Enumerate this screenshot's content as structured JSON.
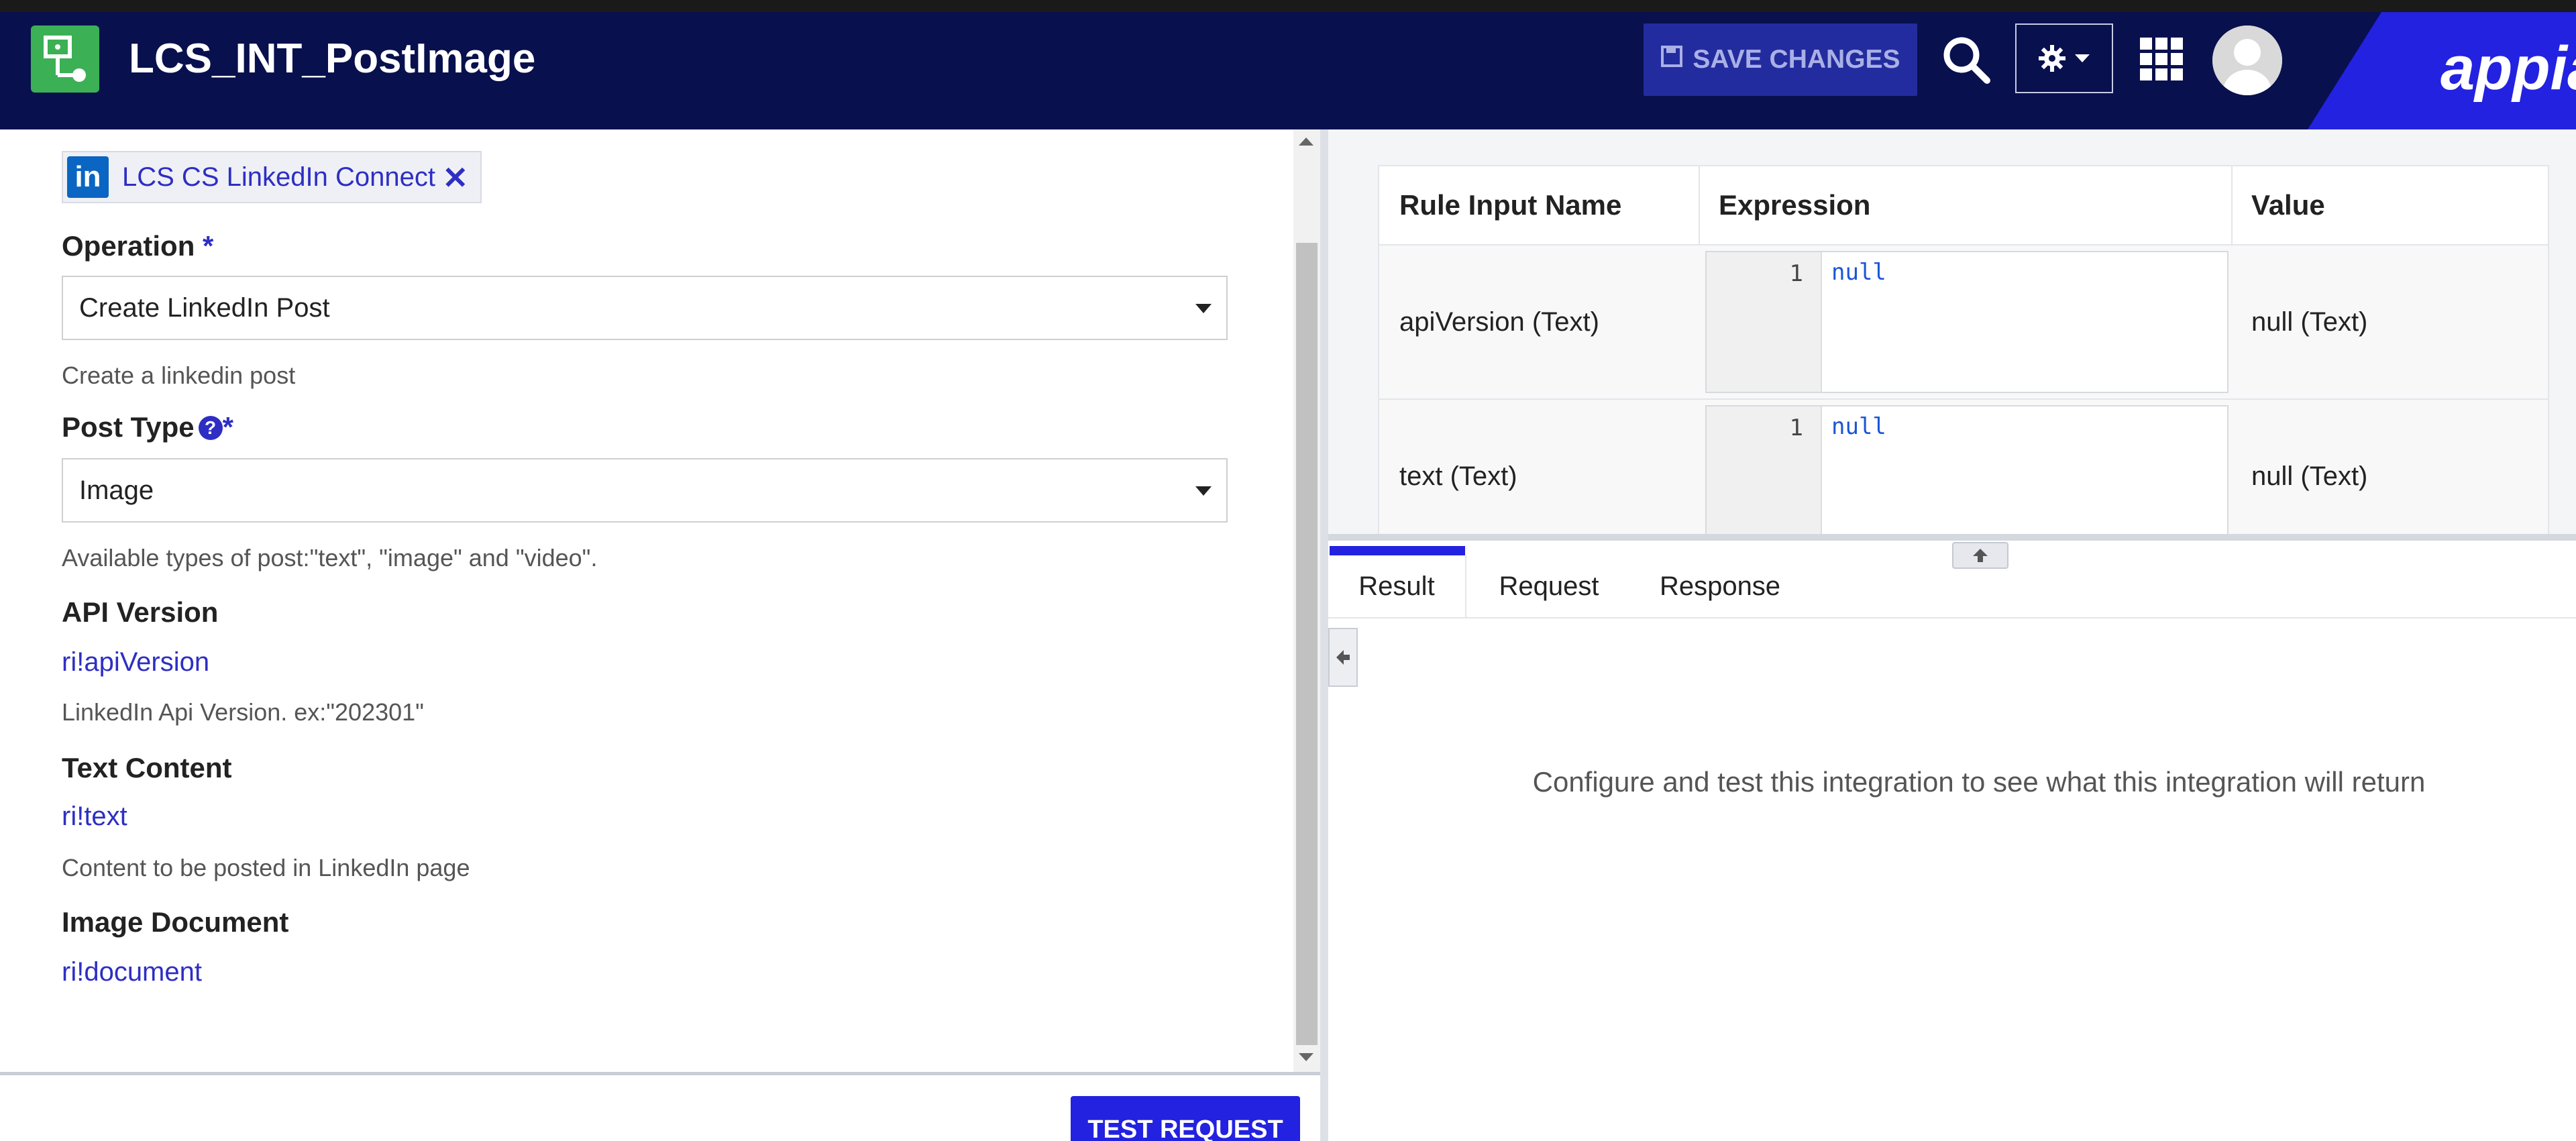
{
  "header": {
    "app_title": "LCS_INT_PostImage",
    "save_label": "SAVE CHANGES",
    "brand": "appia"
  },
  "connection": {
    "label": "LCS CS LinkedIn Connect",
    "logo_text": "in"
  },
  "form": {
    "operation": {
      "label": "Operation",
      "required_mark": "*",
      "value": "Create LinkedIn Post",
      "hint": "Create a linkedin post"
    },
    "post_type": {
      "label": "Post Type",
      "required_mark": "*",
      "help": "?",
      "value": "Image",
      "hint": "Available types of post:\"text\", \"image\" and \"video\"."
    },
    "api_version": {
      "label": "API Version",
      "rule": "ri!apiVersion",
      "hint": "LinkedIn Api Version. ex:\"202301\""
    },
    "text_content": {
      "label": "Text Content",
      "rule": "ri!text",
      "hint": "Content to be posted in LinkedIn page"
    },
    "image_document": {
      "label": "Image Document",
      "rule": "ri!document"
    }
  },
  "test_button": "TEST REQUEST",
  "rule_table": {
    "headers": [
      "Rule Input Name",
      "Expression",
      "Value"
    ],
    "rows": [
      {
        "name": "apiVersion (Text)",
        "line": "1",
        "expr": "null",
        "value": "null (Text)"
      },
      {
        "name": "text (Text)",
        "line": "1",
        "expr": "null",
        "value": "null (Text)"
      }
    ]
  },
  "result_tabs": [
    "Result",
    "Request",
    "Response"
  ],
  "empty_message": "Configure and test this integration to see what this integration will return",
  "colors": {
    "header_bg": "#08104e",
    "accent": "#2322e0",
    "link": "#2e2ec4",
    "app_icon": "#3bb054"
  }
}
